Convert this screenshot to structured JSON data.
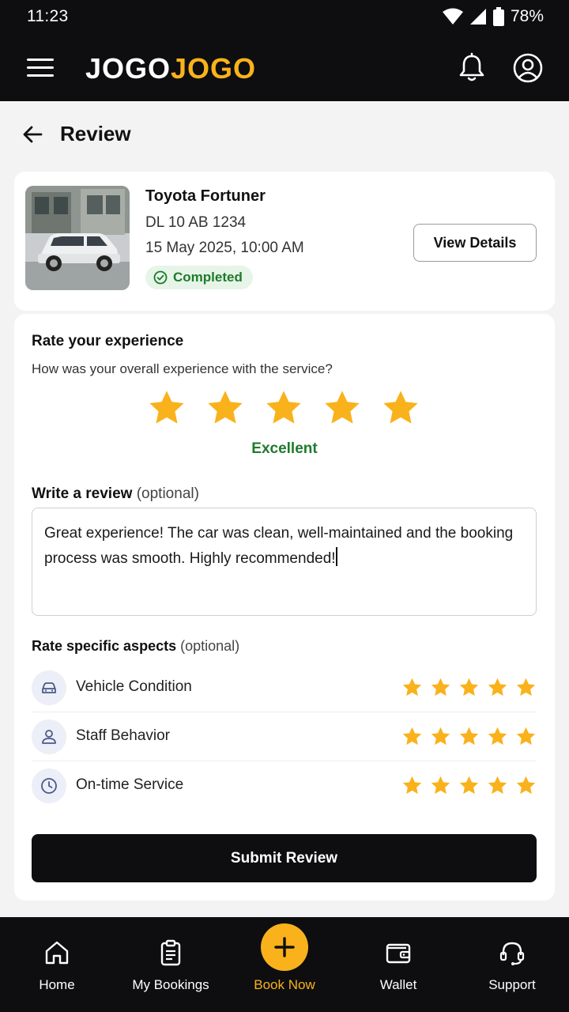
{
  "status_bar": {
    "time": "11:23",
    "battery": "78%"
  },
  "app": {
    "logo_part1": "JOGO",
    "logo_part2": "JOGO"
  },
  "page": {
    "title": "Review"
  },
  "booking": {
    "car_name": "Toyota Fortuner",
    "plate": "DL 10 AB 1234",
    "datetime": "15 May 2025, 10:00 AM",
    "status": "Completed",
    "view_details_label": "View Details"
  },
  "rating": {
    "title": "Rate your experience",
    "question": "How was your overall experience with the service?",
    "stars": 5,
    "max_stars": 5,
    "label": "Excellent"
  },
  "review": {
    "label": "Write a review",
    "optional": "(optional)",
    "text": "Great experience! The car was clean, well-maintained and the booking process was smooth. Highly recommended!"
  },
  "aspects": {
    "label": "Rate specific aspects",
    "optional": "(optional)",
    "items": [
      {
        "name": "Vehicle Condition",
        "icon": "car-icon",
        "stars": 5
      },
      {
        "name": "Staff Behavior",
        "icon": "person-icon",
        "stars": 5
      },
      {
        "name": "On-time Service",
        "icon": "clock-icon",
        "stars": 5
      }
    ]
  },
  "submit_label": "Submit Review",
  "nav": {
    "items": [
      {
        "label": "Home",
        "icon": "home-icon"
      },
      {
        "label": "My Bookings",
        "icon": "clipboard-icon"
      },
      {
        "label": "Book Now",
        "icon": "plus-icon",
        "active": true
      },
      {
        "label": "Wallet",
        "icon": "wallet-icon"
      },
      {
        "label": "Support",
        "icon": "headset-icon"
      }
    ]
  },
  "colors": {
    "accent": "#f9b21b",
    "star": "#f9b21b",
    "success": "#1f7a2c",
    "dark": "#0e0e10"
  }
}
